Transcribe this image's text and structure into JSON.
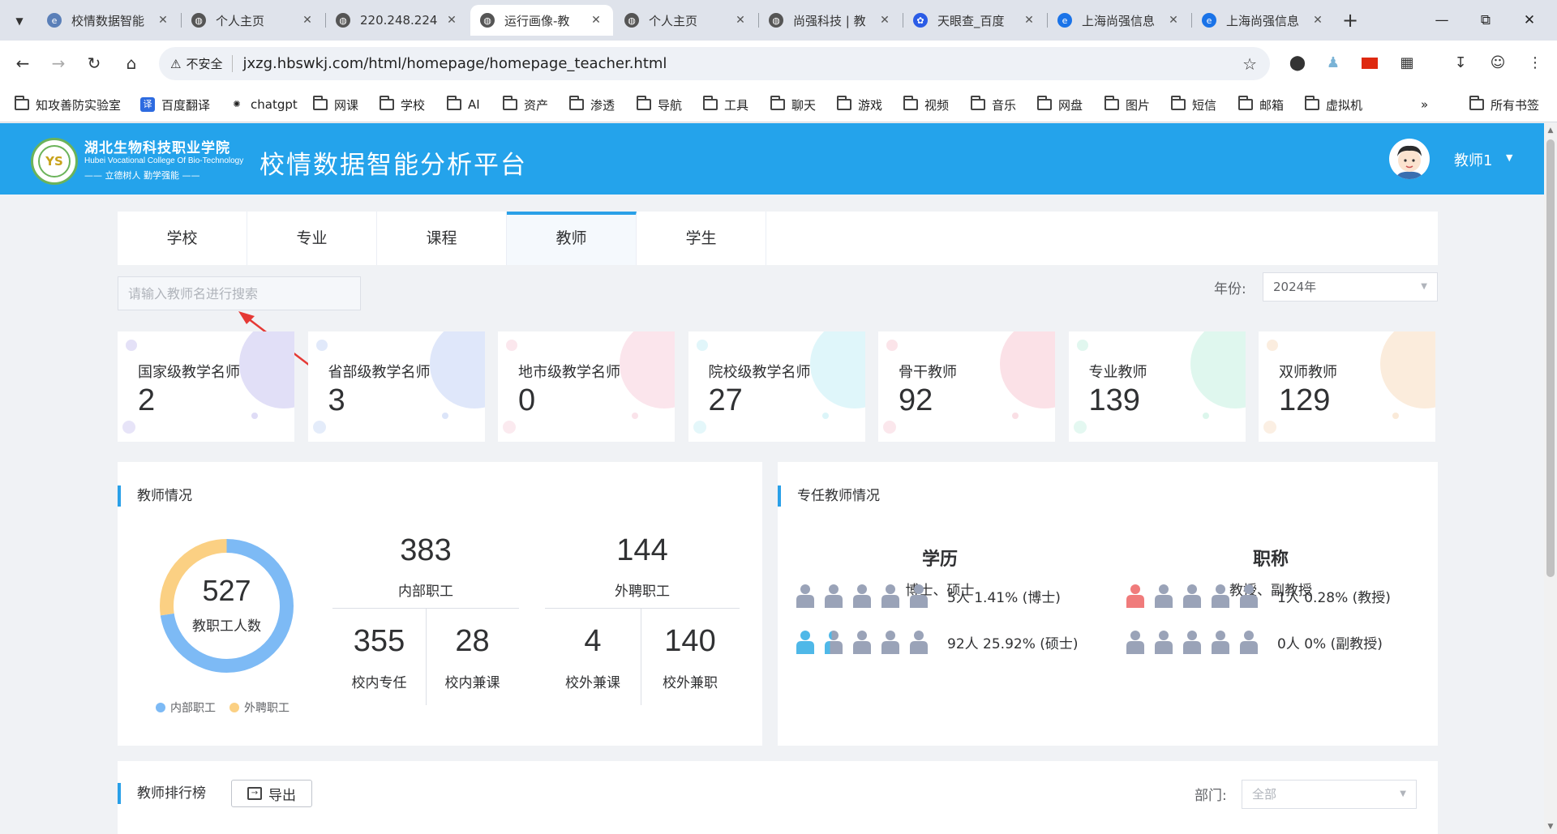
{
  "browser": {
    "tabs": [
      {
        "title": "校情数据智能",
        "color": "#5a7fb8",
        "icon": "site-favicon-icon"
      },
      {
        "title": "个人主页",
        "color": "#555555",
        "icon": "globe-icon"
      },
      {
        "title": "220.248.224",
        "color": "#555555",
        "icon": "globe-icon"
      },
      {
        "title": "运行画像-教",
        "color": "#555555",
        "icon": "globe-icon"
      },
      {
        "title": "个人主页",
        "color": "#555555",
        "icon": "globe-icon"
      },
      {
        "title": "尚强科技 | 教",
        "color": "#555555",
        "icon": "globe-icon"
      },
      {
        "title": "天眼查_百度",
        "color": "#2b5ce6",
        "icon": "baidu-paw-icon"
      },
      {
        "title": "上海尚强信息",
        "color": "#1a73e8",
        "icon": "edge-icon"
      },
      {
        "title": "上海尚强信息",
        "color": "#1a73e8",
        "icon": "edge-icon"
      }
    ],
    "active_tab_index": 3,
    "address": {
      "security_label": "不安全",
      "url": "jxzg.hbswkj.com/html/homepage/homepage_teacher.html"
    },
    "bookmarks": [
      {
        "label": "知攻善防实验室",
        "type": "folder"
      },
      {
        "label": "百度翻译",
        "type": "site"
      },
      {
        "label": "chatgpt",
        "type": "site"
      },
      {
        "label": "网课",
        "type": "folder"
      },
      {
        "label": "学校",
        "type": "folder"
      },
      {
        "label": "AI",
        "type": "folder"
      },
      {
        "label": "资产",
        "type": "folder"
      },
      {
        "label": "渗透",
        "type": "folder"
      },
      {
        "label": "导航",
        "type": "folder"
      },
      {
        "label": "工具",
        "type": "folder"
      },
      {
        "label": "聊天",
        "type": "folder"
      },
      {
        "label": "游戏",
        "type": "folder"
      },
      {
        "label": "视频",
        "type": "folder"
      },
      {
        "label": "音乐",
        "type": "folder"
      },
      {
        "label": "网盘",
        "type": "folder"
      },
      {
        "label": "图片",
        "type": "folder"
      },
      {
        "label": "短信",
        "type": "folder"
      },
      {
        "label": "邮箱",
        "type": "folder"
      },
      {
        "label": "虚拟机",
        "type": "folder"
      }
    ],
    "bookmarks_overflow": "»",
    "all_bookmarks": "所有书签"
  },
  "header": {
    "logo_text": "YS",
    "school_name_cn": "湖北生物科技职业学院",
    "school_name_en": "Hubei Vocational College Of Bio-Technology",
    "motto": "—— 立德树人  勤学强能 ——",
    "platform_title": "校情数据智能分析平台",
    "user_name": "教师1"
  },
  "nav_tabs": [
    "学校",
    "专业",
    "课程",
    "教师",
    "学生"
  ],
  "active_nav": "教师",
  "search": {
    "placeholder": "请输入教师名进行搜索"
  },
  "year_filter": {
    "label": "年份:",
    "value": "2024年"
  },
  "stat_cards": [
    {
      "label": "国家级教学名师",
      "value": "2",
      "accent": "#c9c4f0"
    },
    {
      "label": "省部级教学名师",
      "value": "3",
      "accent": "#c4d4f5"
    },
    {
      "label": "地市级教学名师",
      "value": "0",
      "accent": "#f7d0dc"
    },
    {
      "label": "院校级教学名师",
      "value": "27",
      "accent": "#c4eef5"
    },
    {
      "label": "骨干教师",
      "value": "92",
      "accent": "#f7c9d4"
    },
    {
      "label": "专业教师",
      "value": "139",
      "accent": "#c4f0e0"
    },
    {
      "label": "双师教师",
      "value": "129",
      "accent": "#f7dcc0"
    }
  ],
  "staff_panel": {
    "title": "教师情况",
    "total": "527",
    "total_label": "教职工人数",
    "donut": [
      {
        "name": "内部职工",
        "value": 383,
        "color": "#7dbaf5"
      },
      {
        "name": "外聘职工",
        "value": 144,
        "color": "#fbd083"
      }
    ],
    "groups": [
      {
        "value": "383",
        "label": "内部职工",
        "subs": [
          {
            "value": "355",
            "label": "校内专任"
          },
          {
            "value": "28",
            "label": "校内兼课"
          }
        ]
      },
      {
        "value": "144",
        "label": "外聘职工",
        "subs": [
          {
            "value": "4",
            "label": "校外兼课"
          },
          {
            "value": "140",
            "label": "校外兼职"
          }
        ]
      }
    ]
  },
  "fulltime_panel": {
    "title": "专任教师情况",
    "columns": [
      {
        "heading": "学历",
        "sub": "博士、硕士",
        "rows": [
          {
            "text": "5人 1.41% (博士)",
            "highlight": 0,
            "highlight_color": "#4fb8e8"
          },
          {
            "text": "92人 25.92% (硕士)",
            "highlight": 1.3,
            "highlight_color": "#4fb8e8"
          }
        ]
      },
      {
        "heading": "职称",
        "sub": "教授、副教授",
        "rows": [
          {
            "text": "1人 0.28% (教授)",
            "highlight": 1,
            "highlight_color": "#f07b7b"
          },
          {
            "text": "0人 0% (副教授)",
            "highlight": 0,
            "highlight_color": "#f07b7b"
          }
        ]
      }
    ],
    "person_color": "#9aa3b8"
  },
  "ranking": {
    "title": "教师排行榜",
    "export_label": "导出",
    "dept_label": "部门:",
    "dept_value": "全部"
  }
}
